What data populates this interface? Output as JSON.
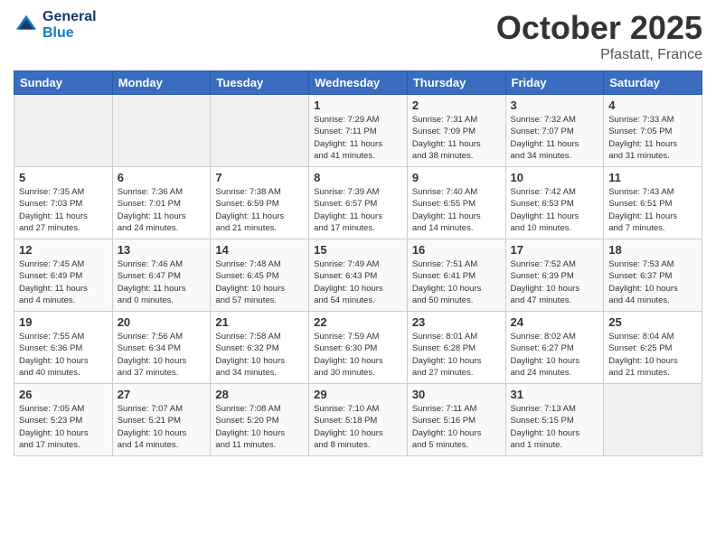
{
  "header": {
    "logo_line1": "General",
    "logo_line2": "Blue",
    "month": "October 2025",
    "location": "Pfastatt, France"
  },
  "days_of_week": [
    "Sunday",
    "Monday",
    "Tuesday",
    "Wednesday",
    "Thursday",
    "Friday",
    "Saturday"
  ],
  "weeks": [
    [
      {
        "day": "",
        "info": ""
      },
      {
        "day": "",
        "info": ""
      },
      {
        "day": "",
        "info": ""
      },
      {
        "day": "1",
        "info": "Sunrise: 7:29 AM\nSunset: 7:11 PM\nDaylight: 11 hours\nand 41 minutes."
      },
      {
        "day": "2",
        "info": "Sunrise: 7:31 AM\nSunset: 7:09 PM\nDaylight: 11 hours\nand 38 minutes."
      },
      {
        "day": "3",
        "info": "Sunrise: 7:32 AM\nSunset: 7:07 PM\nDaylight: 11 hours\nand 34 minutes."
      },
      {
        "day": "4",
        "info": "Sunrise: 7:33 AM\nSunset: 7:05 PM\nDaylight: 11 hours\nand 31 minutes."
      }
    ],
    [
      {
        "day": "5",
        "info": "Sunrise: 7:35 AM\nSunset: 7:03 PM\nDaylight: 11 hours\nand 27 minutes."
      },
      {
        "day": "6",
        "info": "Sunrise: 7:36 AM\nSunset: 7:01 PM\nDaylight: 11 hours\nand 24 minutes."
      },
      {
        "day": "7",
        "info": "Sunrise: 7:38 AM\nSunset: 6:59 PM\nDaylight: 11 hours\nand 21 minutes."
      },
      {
        "day": "8",
        "info": "Sunrise: 7:39 AM\nSunset: 6:57 PM\nDaylight: 11 hours\nand 17 minutes."
      },
      {
        "day": "9",
        "info": "Sunrise: 7:40 AM\nSunset: 6:55 PM\nDaylight: 11 hours\nand 14 minutes."
      },
      {
        "day": "10",
        "info": "Sunrise: 7:42 AM\nSunset: 6:53 PM\nDaylight: 11 hours\nand 10 minutes."
      },
      {
        "day": "11",
        "info": "Sunrise: 7:43 AM\nSunset: 6:51 PM\nDaylight: 11 hours\nand 7 minutes."
      }
    ],
    [
      {
        "day": "12",
        "info": "Sunrise: 7:45 AM\nSunset: 6:49 PM\nDaylight: 11 hours\nand 4 minutes."
      },
      {
        "day": "13",
        "info": "Sunrise: 7:46 AM\nSunset: 6:47 PM\nDaylight: 11 hours\nand 0 minutes."
      },
      {
        "day": "14",
        "info": "Sunrise: 7:48 AM\nSunset: 6:45 PM\nDaylight: 10 hours\nand 57 minutes."
      },
      {
        "day": "15",
        "info": "Sunrise: 7:49 AM\nSunset: 6:43 PM\nDaylight: 10 hours\nand 54 minutes."
      },
      {
        "day": "16",
        "info": "Sunrise: 7:51 AM\nSunset: 6:41 PM\nDaylight: 10 hours\nand 50 minutes."
      },
      {
        "day": "17",
        "info": "Sunrise: 7:52 AM\nSunset: 6:39 PM\nDaylight: 10 hours\nand 47 minutes."
      },
      {
        "day": "18",
        "info": "Sunrise: 7:53 AM\nSunset: 6:37 PM\nDaylight: 10 hours\nand 44 minutes."
      }
    ],
    [
      {
        "day": "19",
        "info": "Sunrise: 7:55 AM\nSunset: 6:36 PM\nDaylight: 10 hours\nand 40 minutes."
      },
      {
        "day": "20",
        "info": "Sunrise: 7:56 AM\nSunset: 6:34 PM\nDaylight: 10 hours\nand 37 minutes."
      },
      {
        "day": "21",
        "info": "Sunrise: 7:58 AM\nSunset: 6:32 PM\nDaylight: 10 hours\nand 34 minutes."
      },
      {
        "day": "22",
        "info": "Sunrise: 7:59 AM\nSunset: 6:30 PM\nDaylight: 10 hours\nand 30 minutes."
      },
      {
        "day": "23",
        "info": "Sunrise: 8:01 AM\nSunset: 6:28 PM\nDaylight: 10 hours\nand 27 minutes."
      },
      {
        "day": "24",
        "info": "Sunrise: 8:02 AM\nSunset: 6:27 PM\nDaylight: 10 hours\nand 24 minutes."
      },
      {
        "day": "25",
        "info": "Sunrise: 8:04 AM\nSunset: 6:25 PM\nDaylight: 10 hours\nand 21 minutes."
      }
    ],
    [
      {
        "day": "26",
        "info": "Sunrise: 7:05 AM\nSunset: 5:23 PM\nDaylight: 10 hours\nand 17 minutes."
      },
      {
        "day": "27",
        "info": "Sunrise: 7:07 AM\nSunset: 5:21 PM\nDaylight: 10 hours\nand 14 minutes."
      },
      {
        "day": "28",
        "info": "Sunrise: 7:08 AM\nSunset: 5:20 PM\nDaylight: 10 hours\nand 11 minutes."
      },
      {
        "day": "29",
        "info": "Sunrise: 7:10 AM\nSunset: 5:18 PM\nDaylight: 10 hours\nand 8 minutes."
      },
      {
        "day": "30",
        "info": "Sunrise: 7:11 AM\nSunset: 5:16 PM\nDaylight: 10 hours\nand 5 minutes."
      },
      {
        "day": "31",
        "info": "Sunrise: 7:13 AM\nSunset: 5:15 PM\nDaylight: 10 hours\nand 1 minute."
      },
      {
        "day": "",
        "info": ""
      }
    ]
  ]
}
